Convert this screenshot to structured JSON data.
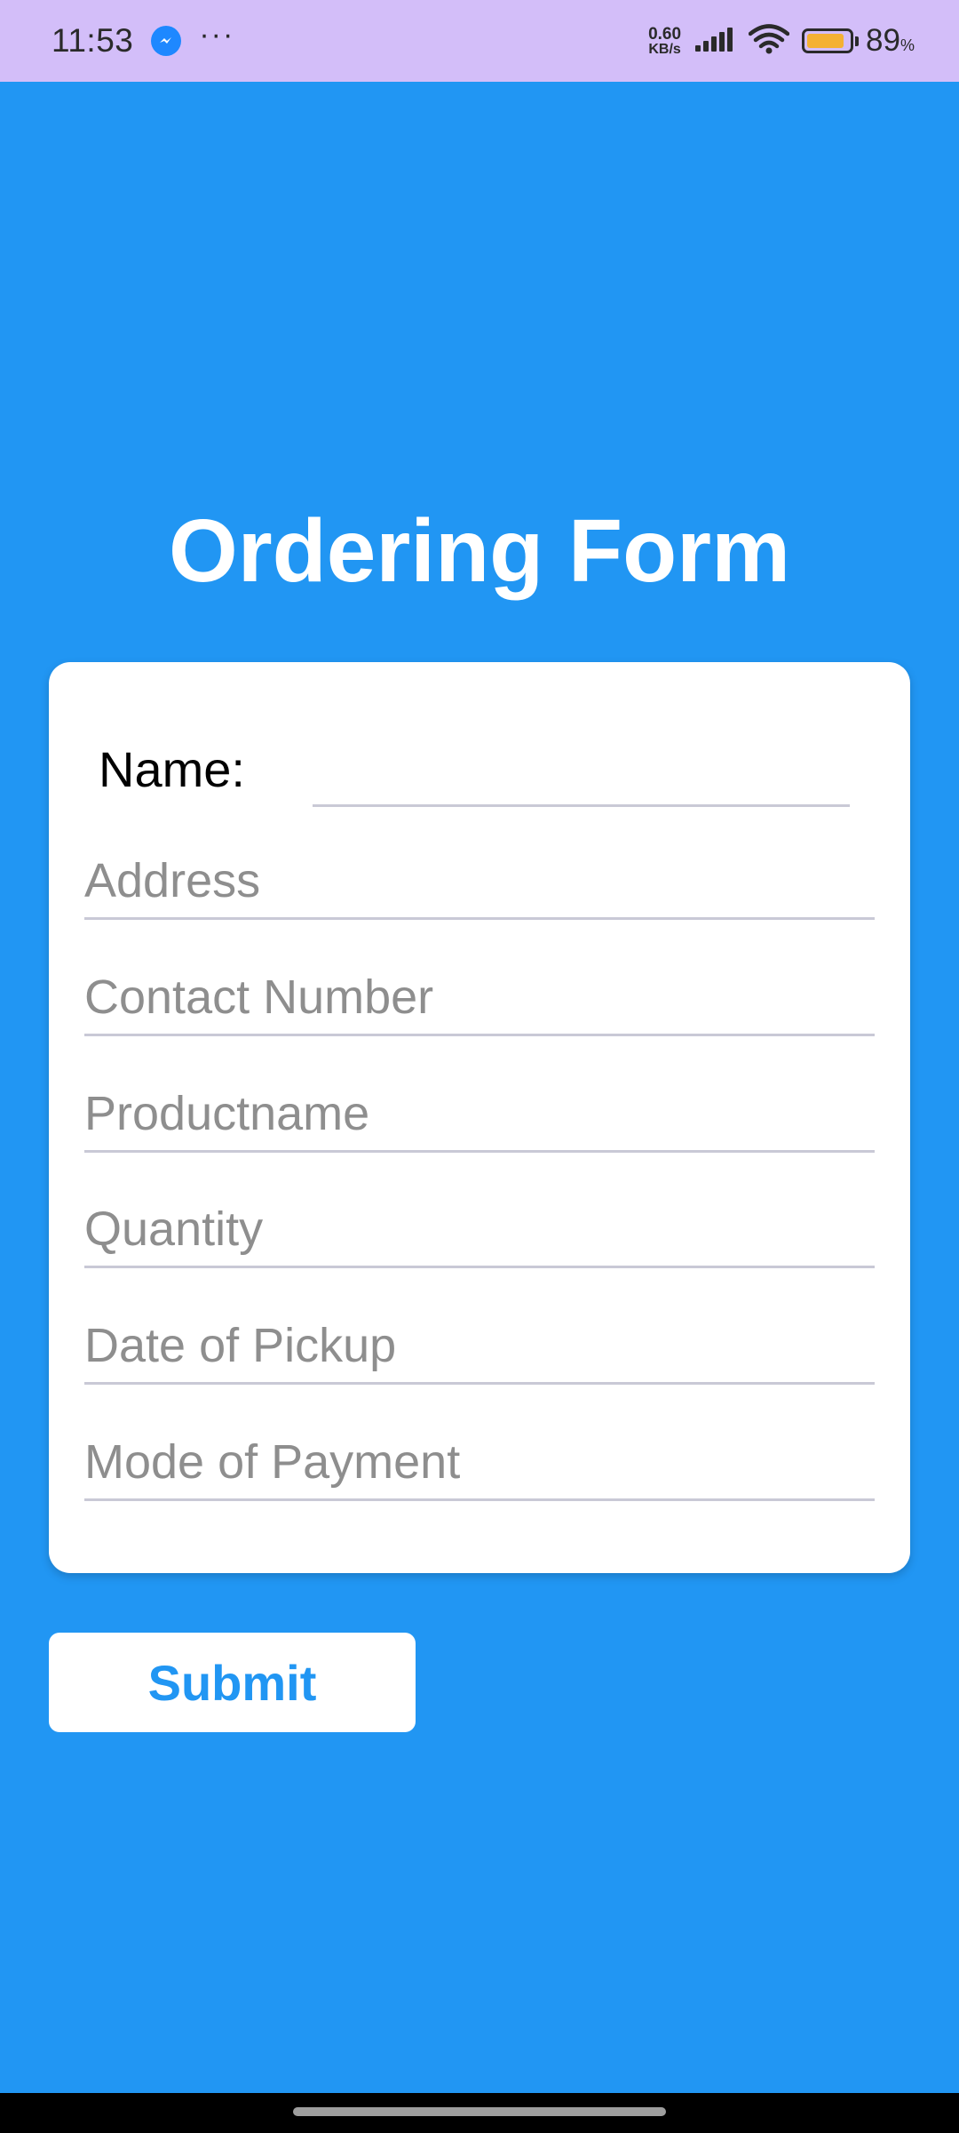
{
  "status_bar": {
    "time": "11:53",
    "more_dots": "···",
    "net_speed_value": "0.60",
    "net_speed_unit": "KB/s",
    "battery_percent": "89",
    "battery_percent_sign": "%",
    "battery_level": 0.89,
    "battery_color": "#F4B133",
    "icons": [
      "messenger-icon",
      "signal-icon",
      "wifi-icon",
      "battery-icon"
    ]
  },
  "form": {
    "title": "Ordering Form",
    "name_label": "Name:",
    "name_value": "",
    "fields": [
      {
        "placeholder": "Address"
      },
      {
        "placeholder": "Contact Number"
      },
      {
        "placeholder": "Productname"
      },
      {
        "placeholder": "Quantity"
      },
      {
        "placeholder": "Date of Pickup"
      },
      {
        "placeholder": "Mode of Payment"
      }
    ],
    "submit_label": "Submit"
  },
  "colors": {
    "background": "#2196F3",
    "status_bar": "#D3BEF9",
    "card": "#FFFFFF",
    "accent": "#2196F3"
  }
}
